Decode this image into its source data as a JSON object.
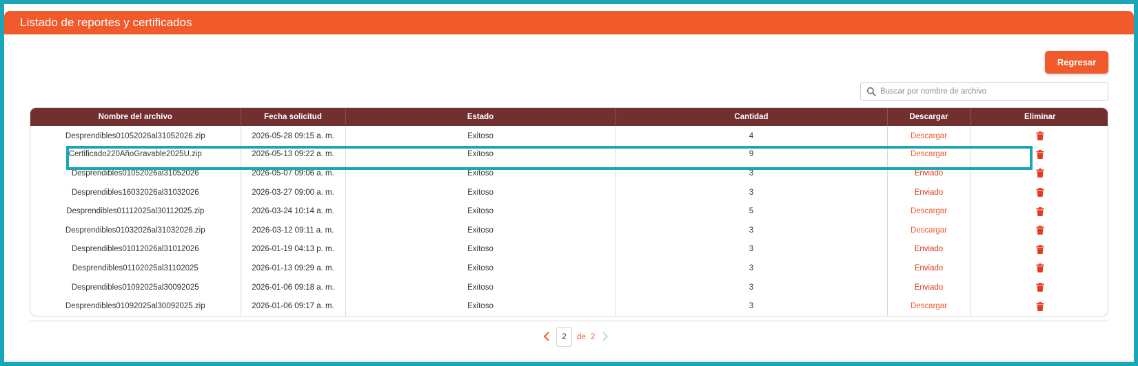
{
  "header": {
    "title": "Listado de reportes y certificados"
  },
  "toolbar": {
    "back_label": "Regresar"
  },
  "search": {
    "placeholder": "Buscar por nombre de archivo",
    "value": ""
  },
  "table": {
    "columns": [
      "Nombre del archivo",
      "Fecha solicitud",
      "Estado",
      "Cantidad",
      "Descargar",
      "Eliminar"
    ],
    "rows": [
      {
        "name": "Desprendibles01052026al31052026.zip",
        "date": "2026-05-28 09:15 a. m.",
        "status": "Exitoso",
        "qty": "4",
        "action": "Descargar",
        "action_type": "link"
      },
      {
        "name": "Certificado220AñoGravable2025U.zip",
        "date": "2026-05-13 09:22 a. m.",
        "status": "Exitoso",
        "qty": "9",
        "action": "Descargar",
        "action_type": "link"
      },
      {
        "name": "Desprendibles01052026al31052026",
        "date": "2026-05-07 09:06 a. m.",
        "status": "Exitoso",
        "qty": "3",
        "action": "Enviado",
        "action_type": "text"
      },
      {
        "name": "Desprendibles16032026al31032026",
        "date": "2026-03-27 09:00 a. m.",
        "status": "Exitoso",
        "qty": "3",
        "action": "Enviado",
        "action_type": "text"
      },
      {
        "name": "Desprendibles01112025al30112025.zip",
        "date": "2026-03-24 10:14 a. m.",
        "status": "Exitoso",
        "qty": "5",
        "action": "Descargar",
        "action_type": "link"
      },
      {
        "name": "Desprendibles01032026al31032026.zip",
        "date": "2026-03-12 09:11 a. m.",
        "status": "Exitoso",
        "qty": "3",
        "action": "Descargar",
        "action_type": "link"
      },
      {
        "name": "Desprendibles01012026al31012026",
        "date": "2026-01-19 04:13 p. m.",
        "status": "Exitoso",
        "qty": "3",
        "action": "Enviado",
        "action_type": "text"
      },
      {
        "name": "Desprendibles01102025al31102025",
        "date": "2026-01-13 09:29 a. m.",
        "status": "Exitoso",
        "qty": "3",
        "action": "Enviado",
        "action_type": "text"
      },
      {
        "name": "Desprendibles01092025al30092025",
        "date": "2026-01-06 09:18 a. m.",
        "status": "Exitoso",
        "qty": "3",
        "action": "Enviado",
        "action_type": "text"
      },
      {
        "name": "Desprendibles01092025al30092025.zip",
        "date": "2026-01-06 09:17 a. m.",
        "status": "Exitoso",
        "qty": "3",
        "action": "Descargar",
        "action_type": "link"
      }
    ]
  },
  "pagination": {
    "current_page": "2",
    "of_label": "de",
    "total_pages": "2"
  },
  "icons": {
    "search": "search-icon",
    "delete": "trash-icon",
    "prev": "chevron-left-icon",
    "next": "chevron-right-icon"
  },
  "colors": {
    "brand": "#f15a2b",
    "table_header": "#722f2f",
    "highlight": "#1aa5b8",
    "sent": "#d9391b"
  }
}
